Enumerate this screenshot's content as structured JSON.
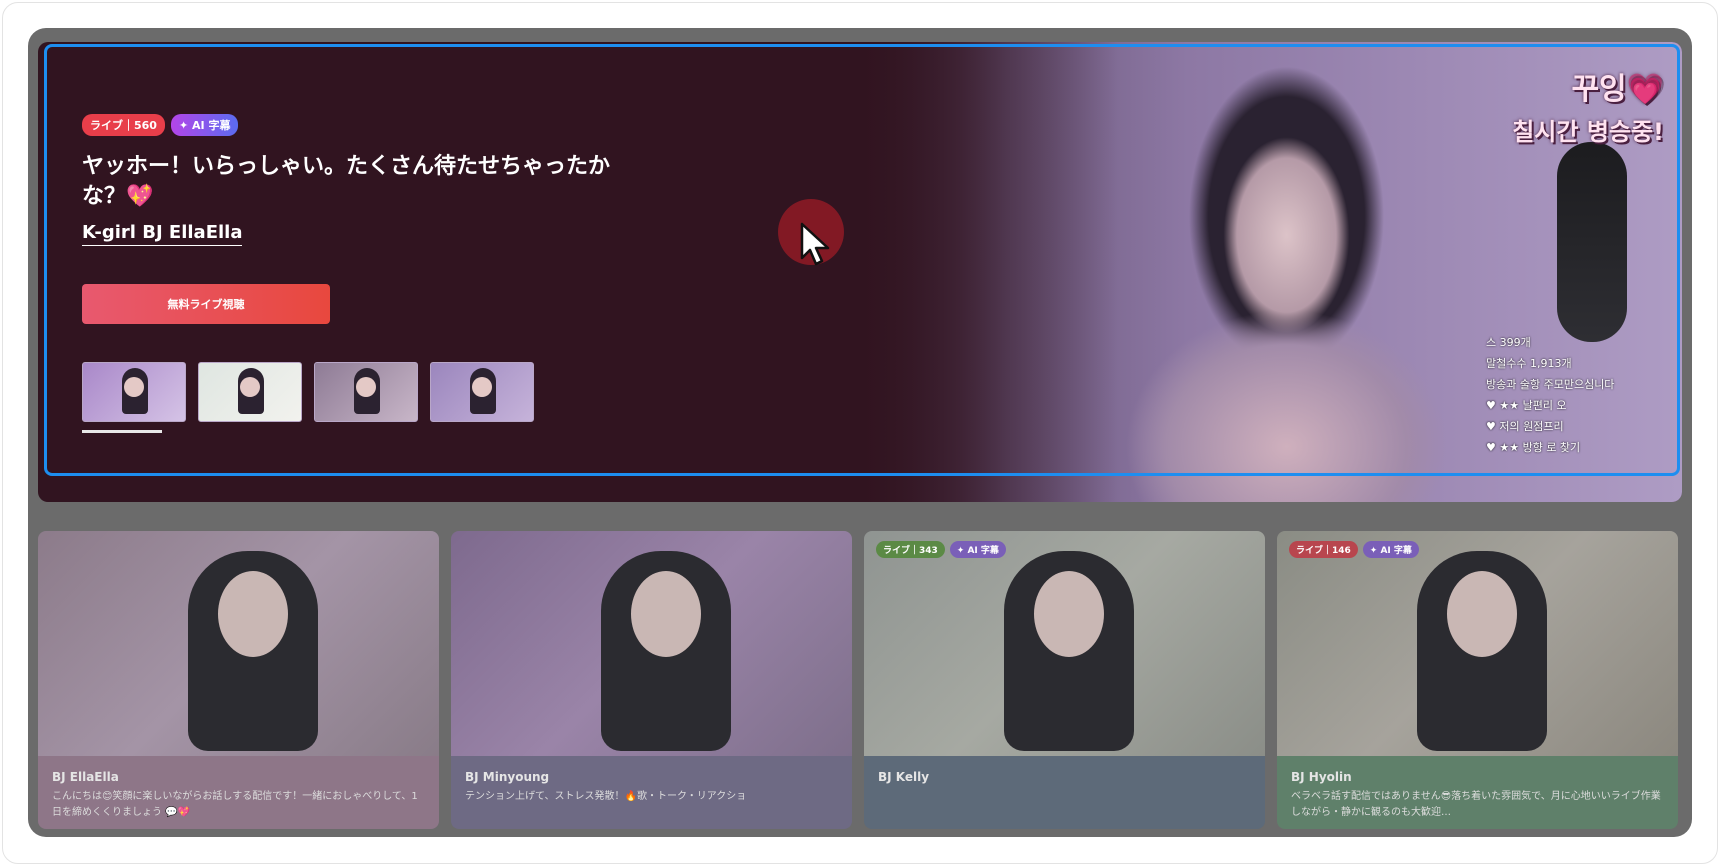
{
  "hero": {
    "badge_live": "ライブ｜560",
    "badge_ai": "✦ AI 字幕",
    "title": "ヤッホー！いらっしゃい。たくさん待たせちゃったかな？💖",
    "streamer": "K-girl BJ EllaElla",
    "cta": "無料ライブ視聴",
    "overlay_line1": "꾸잉💗",
    "overlay_line2": "칠시간 병승중!",
    "chat_lines": [
      "스 399개",
      "말철수수 1,913개",
      "방송과 술항 주모만으심니다",
      "♥ ★★ 날편리 오",
      "♥ 저의 원점프리",
      "♥ ★★ 방향 로 찾기"
    ],
    "thumbnails": [
      "thumb-1",
      "thumb-2",
      "thumb-3",
      "thumb-4"
    ],
    "active_thumbnail_index": 0
  },
  "cards": [
    {
      "name": "BJ EllaElla",
      "desc": "こんにちは😊笑顔に楽しいながらお話しする配信です！一緒におしゃべりして、1日を締めくくりましょう 💬💖",
      "badges": []
    },
    {
      "name": "BJ Minyoung",
      "desc": "テンション上げて、ストレス発散！🔥歌・トーク・リアクショ",
      "badges": []
    },
    {
      "name": "BJ Kelly",
      "desc": "",
      "badges": [
        {
          "label": "ライブ｜343",
          "kind": "green"
        },
        {
          "label": "✦ AI 字幕",
          "kind": "ai"
        }
      ]
    },
    {
      "name": "BJ Hyolin",
      "desc": "ベラベラ話す配信ではありません😎落ち着いた雰囲気で、月に心地いいライブ作業しながら・静かに観るのも大歓迎…",
      "badges": [
        {
          "label": "ライブ｜146",
          "kind": "red"
        },
        {
          "label": "✦ AI 字幕",
          "kind": "ai"
        }
      ]
    }
  ],
  "colors": {
    "hero_bg": "#311420",
    "highlight_border": "#1d8ef0",
    "cta_gradient_start": "#e8596f",
    "cta_gradient_end": "#e8483e",
    "badge_live": "#e83e4a"
  },
  "icons": {
    "cursor": "mouse-pointer-icon"
  }
}
